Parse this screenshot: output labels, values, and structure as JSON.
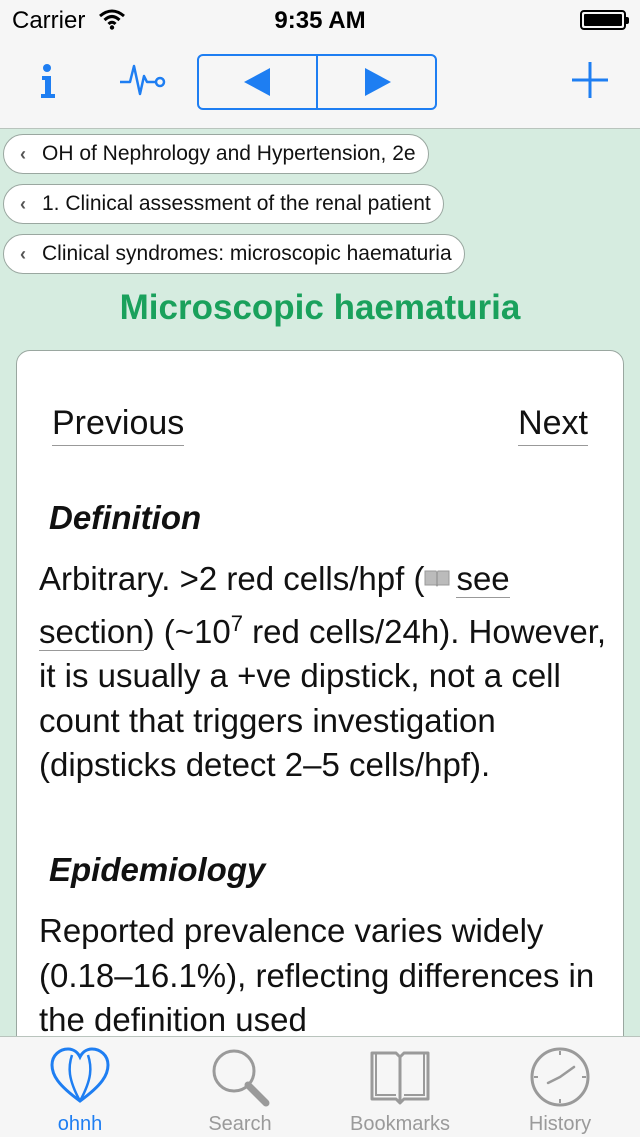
{
  "status": {
    "carrier": "Carrier",
    "time": "9:35 AM"
  },
  "toolbar": {
    "info": "info-icon",
    "pulse": "pulse-icon",
    "back": "back-arrow-icon",
    "forward": "forward-arrow-icon",
    "add": "plus-icon"
  },
  "breadcrumbs": [
    "OH of Nephrology and Hypertension, 2e",
    "1. Clinical assessment of the renal patient",
    "Clinical syndromes: microscopic haematuria"
  ],
  "page_title": "Microscopic haematuria",
  "card": {
    "previous": "Previous",
    "next": "Next",
    "definition_heading": "Definition",
    "definition_text_before": "Arbitrary. >2 red cells/hpf (",
    "definition_link_1": "see",
    "definition_link_2": "section",
    "definition_text_after_1": ") (~10",
    "definition_superscript": "7",
    "definition_text_after_2": " red cells/24h). However, it is usually a +ve dipstick, not a cell count that triggers investigation (dipsticks detect 2–5 cells/hpf).",
    "epidemiology_heading": "Epidemiology",
    "epidemiology_text": "Reported prevalence varies widely (0.18–16.1%), reflecting differences in the definition used"
  },
  "tabs": [
    {
      "label": "ohnh",
      "icon": "heart-icon",
      "active": true
    },
    {
      "label": "Search",
      "icon": "search-icon",
      "active": false
    },
    {
      "label": "Bookmarks",
      "icon": "book-icon",
      "active": false
    },
    {
      "label": "History",
      "icon": "clock-icon",
      "active": false
    }
  ],
  "colors": {
    "accent": "#1e7ef2",
    "title_green": "#1aa15c",
    "background": "#d6ece0"
  }
}
